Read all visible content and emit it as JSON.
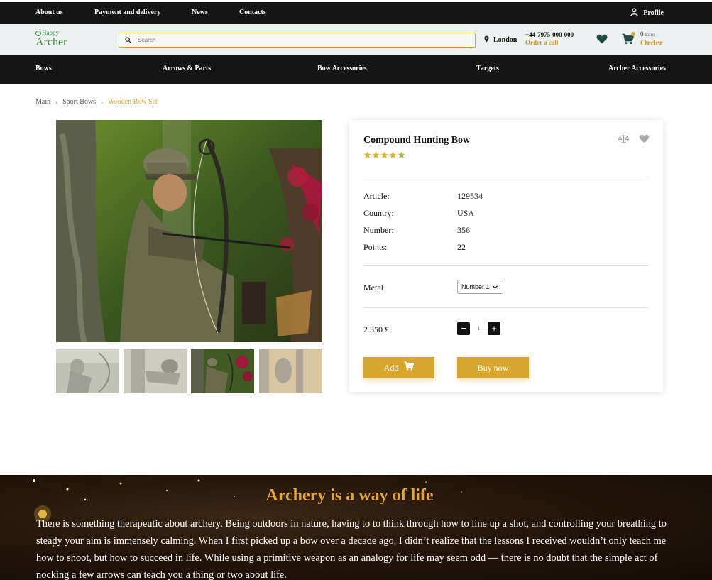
{
  "topbar": {
    "links": [
      "About us",
      "Payment and delivery",
      "News",
      "Contacts"
    ],
    "profile": "Profile"
  },
  "header": {
    "logo_top": "Happy",
    "logo_bottom": "Archer",
    "search_placeholder": "Search",
    "city": "London",
    "phone": "+44-7975-000-000",
    "call_label": "Order a call",
    "cart_count": "0",
    "cart_currency": "Euro",
    "cart_label": "Order"
  },
  "nav": [
    "Bows",
    "Arrows & Parts",
    "Bow Accessories",
    "Targets",
    "Archer Accessories"
  ],
  "breadcrumb": [
    "Main",
    "Sport Bows",
    "Wooden Bow Set"
  ],
  "product": {
    "title": "Compound Hunting Bow",
    "rating": 5,
    "specs": [
      {
        "label": "Article:",
        "value": "129534"
      },
      {
        "label": "Country:",
        "value": "USA"
      },
      {
        "label": "Number:",
        "value": "356"
      },
      {
        "label": "Points:",
        "value": "22"
      }
    ],
    "option_label": "Metal",
    "option_selected": "Number 1",
    "price": "2 350 £",
    "quantity": "1",
    "add_label": "Add",
    "buy_label": "Buy now"
  },
  "banner": {
    "title": "Archery is a way of life",
    "text": "There is something therapeutic about archery. Being outdoors in nature, having to to think through how to line up a shot, and controlling your breathing to steady your aim is immensely calming. When I first picked up a bow over a decade ago, I didn’t realize that the lessons I received wouldn’t only teach me how to shoot, but how to succeed in life. While using a primitive weapon as an analogy for life may seem odd — there is no doubt that the simple act of nocking a few arrows can teach you a thing or two about life."
  },
  "colors": {
    "accent": "#d6a72c",
    "dark": "#151515",
    "brand_green": "#3d8a46",
    "header_bg": "#eef1f1"
  }
}
